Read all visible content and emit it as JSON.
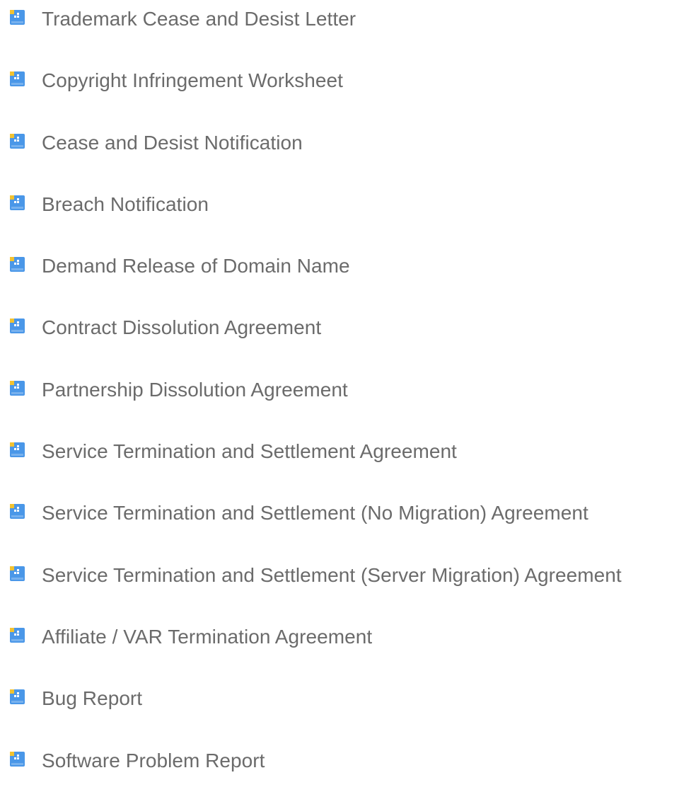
{
  "documents": [
    {
      "label": "Trademark Cease and Desist Letter",
      "icon": "document-icon"
    },
    {
      "label": "Copyright Infringement Worksheet",
      "icon": "document-icon"
    },
    {
      "label": "Cease and Desist Notification",
      "icon": "document-icon"
    },
    {
      "label": "Breach Notification",
      "icon": "document-icon"
    },
    {
      "label": "Demand Release of Domain Name",
      "icon": "document-icon"
    },
    {
      "label": "Contract Dissolution Agreement",
      "icon": "document-icon"
    },
    {
      "label": "Partnership Dissolution Agreement",
      "icon": "document-icon"
    },
    {
      "label": "Service Termination and Settlement Agreement",
      "icon": "document-icon"
    },
    {
      "label": "Service Termination and Settlement (No Migration) Agreement",
      "icon": "document-icon"
    },
    {
      "label": "Service Termination and Settlement (Server Migration) Agreement",
      "icon": "document-icon"
    },
    {
      "label": "Affiliate / VAR Termination Agreement",
      "icon": "document-icon"
    },
    {
      "label": "Bug Report",
      "icon": "document-icon"
    },
    {
      "label": "Software Problem Report",
      "icon": "document-icon"
    }
  ],
  "colors": {
    "text": "#6b6b6b",
    "icon_face": "#4a97e8",
    "icon_corner": "#f2c230",
    "icon_highlight": "#ffffff"
  }
}
